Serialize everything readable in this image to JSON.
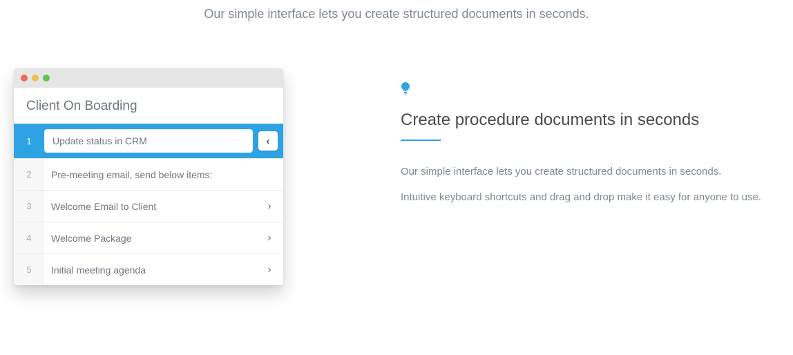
{
  "tagline": "Our simple interface lets you create structured documents in seconds.",
  "app": {
    "document_title": "Client On Boarding",
    "rows": [
      {
        "num": "1",
        "label": "Update status in CRM"
      },
      {
        "num": "2",
        "label": "Pre-meeting email, send below items:"
      },
      {
        "num": "3",
        "label": "Welcome Email to Client"
      },
      {
        "num": "4",
        "label": "Welcome Package"
      },
      {
        "num": "5",
        "label": "Initial meeting agenda"
      }
    ]
  },
  "feature": {
    "icon_name": "lightbulb-icon",
    "headline": "Create procedure documents in seconds",
    "p1": "Our simple interface lets you create structured documents in seconds.",
    "p2": "Intuitive keyboard shortcuts and drag and drop make it easy for anyone to use."
  },
  "colors": {
    "accent": "#2ea3e3",
    "muted_text": "#7c8793",
    "body_text": "#6e7680"
  }
}
